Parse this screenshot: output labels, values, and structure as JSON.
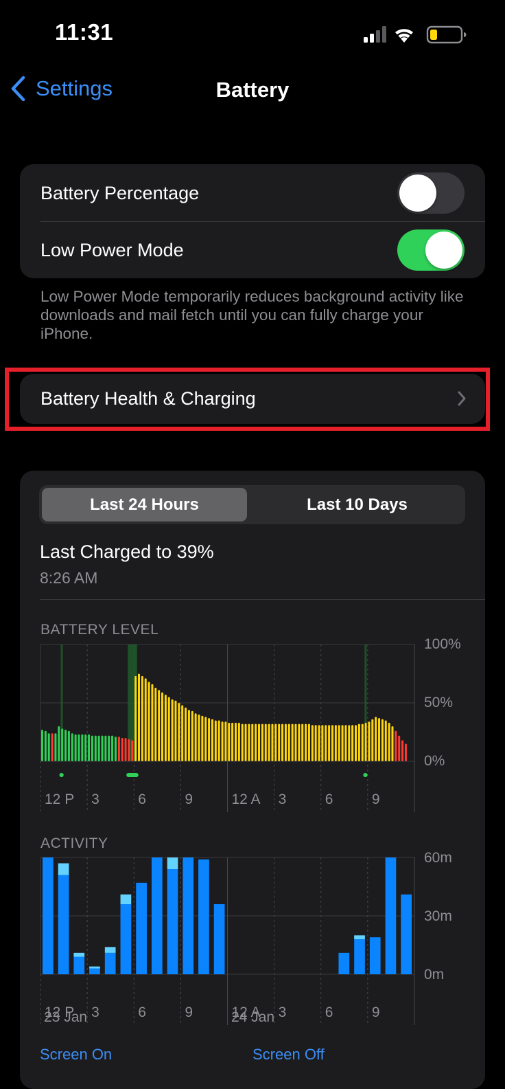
{
  "status": {
    "time": "11:31",
    "battery_color": "#ffd60a",
    "icons": [
      "cellular-signal-icon",
      "wifi-icon",
      "battery-icon"
    ]
  },
  "nav": {
    "back_label": "Settings",
    "title": "Battery"
  },
  "settings": {
    "battery_percentage": {
      "label": "Battery Percentage",
      "on": false
    },
    "low_power_mode": {
      "label": "Low Power Mode",
      "on": true,
      "on_color": "#30d158"
    },
    "footnote": "Low Power Mode temporarily reduces background activity like downloads and mail fetch until you can fully charge your iPhone."
  },
  "health": {
    "label": "Battery Health & Charging"
  },
  "usage": {
    "tabs": [
      "Last 24 Hours",
      "Last 10 Days"
    ],
    "selected_tab": 0,
    "last_charged_title": "Last Charged to 39%",
    "last_charged_time": "8:26 AM",
    "battery_level_label": "BATTERY LEVEL",
    "activity_label": "ACTIVITY",
    "battery_y_ticks": [
      "100%",
      "50%",
      "0%"
    ],
    "activity_y_ticks": [
      "60m",
      "30m",
      "0m"
    ],
    "x_ticks": [
      "12 P",
      "3",
      "6",
      "9",
      "12 A",
      "3",
      "6",
      "9"
    ],
    "dates": [
      "23 Jan",
      "24 Jan"
    ],
    "legend": [
      "Screen On",
      "Screen Off"
    ]
  },
  "chart_data": [
    {
      "type": "bar",
      "title": "BATTERY LEVEL",
      "ylim": [
        0,
        100
      ],
      "y_ticks": [
        "100%",
        "50%",
        "0%"
      ],
      "x_ticks": [
        "12 P",
        "3",
        "6",
        "9",
        "12 A",
        "3",
        "6",
        "9"
      ],
      "colors": {
        "normal": "#30d158",
        "low_power": "#ffd60a",
        "low": "#ff3b30",
        "charging": "#1f5f2c"
      },
      "values": [
        27,
        26,
        24,
        24,
        24,
        30,
        28,
        27,
        26,
        24,
        23,
        23,
        23,
        23,
        23,
        22,
        22,
        22,
        22,
        22,
        22,
        22,
        21,
        21,
        20,
        20,
        19,
        18,
        73,
        75,
        73,
        71,
        68,
        66,
        63,
        61,
        59,
        57,
        55,
        53,
        52,
        50,
        48,
        46,
        44,
        43,
        41,
        40,
        39,
        38,
        37,
        36,
        35,
        35,
        34,
        34,
        33,
        33,
        33,
        33,
        32,
        32,
        32,
        32,
        32,
        32,
        32,
        32,
        32,
        32,
        32,
        32,
        32,
        32,
        32,
        32,
        32,
        32,
        32,
        32,
        32,
        31,
        31,
        31,
        31,
        31,
        31,
        31,
        31,
        31,
        31,
        31,
        31,
        31,
        31,
        32,
        32,
        33,
        34,
        36,
        38,
        37,
        36,
        35,
        33,
        30,
        26,
        22,
        18,
        15
      ],
      "value_colors": [
        "normal",
        "normal",
        "normal",
        "low",
        "normal",
        "normal",
        "normal",
        "normal",
        "normal",
        "normal",
        "normal",
        "normal",
        "normal",
        "normal",
        "normal",
        "normal",
        "normal",
        "normal",
        "normal",
        "normal",
        "normal",
        "normal",
        "normal",
        "low",
        "low",
        "low",
        "low",
        "low",
        "low_power",
        "low_power",
        "low_power",
        "low_power",
        "low_power",
        "low_power",
        "low_power",
        "low_power",
        "low_power",
        "low_power",
        "low_power",
        "low_power",
        "low_power",
        "low_power",
        "low_power",
        "low_power",
        "low_power",
        "low_power",
        "low_power",
        "low_power",
        "low_power",
        "low_power",
        "low_power",
        "low_power",
        "low_power",
        "low_power",
        "low_power",
        "low_power",
        "low_power",
        "low_power",
        "low_power",
        "low_power",
        "low_power",
        "low_power",
        "low_power",
        "low_power",
        "low_power",
        "low_power",
        "low_power",
        "low_power",
        "low_power",
        "low_power",
        "low_power",
        "low_power",
        "low_power",
        "low_power",
        "low_power",
        "low_power",
        "low_power",
        "low_power",
        "low_power",
        "low_power",
        "low_power",
        "low_power",
        "low_power",
        "low_power",
        "low_power",
        "low_power",
        "low_power",
        "low_power",
        "low_power",
        "low_power",
        "low_power",
        "low_power",
        "low_power",
        "low_power",
        "low_power",
        "low_power",
        "low_power",
        "low_power",
        "low_power",
        "low_power",
        "low_power",
        "low_power",
        "low_power",
        "low_power",
        "low_power",
        "low_power",
        "low",
        "low",
        "low",
        "low"
      ],
      "charging_periods_hours": [
        [
          1.3,
          1.4
        ],
        [
          5.6,
          6.2
        ],
        [
          20.8,
          20.9
        ]
      ]
    },
    {
      "type": "bar",
      "title": "ACTIVITY",
      "ylim": [
        0,
        60
      ],
      "y_ticks": [
        "60m",
        "30m",
        "0m"
      ],
      "x_ticks": [
        "12 P",
        "3",
        "6",
        "9",
        "12 A",
        "3",
        "6",
        "9"
      ],
      "categories": [
        "12",
        "13",
        "14",
        "15",
        "16",
        "17",
        "18",
        "19",
        "20",
        "21",
        "22",
        "23",
        "0",
        "1",
        "2",
        "3",
        "4",
        "5",
        "6",
        "7",
        "8",
        "9",
        "10",
        "11"
      ],
      "series": [
        {
          "name": "Screen On",
          "color": "#0a84ff",
          "values": [
            60,
            51,
            9,
            3,
            11,
            36,
            47,
            60,
            54,
            60,
            59,
            36,
            0,
            0,
            0,
            0,
            0,
            0,
            0,
            11,
            18,
            19,
            60,
            41
          ]
        },
        {
          "name": "Screen Off",
          "color": "#64d2ff",
          "values": [
            0,
            6,
            2,
            1,
            3,
            5,
            0,
            0,
            6,
            0,
            0,
            0,
            0,
            0,
            0,
            0,
            0,
            0,
            0,
            0,
            2,
            0,
            0,
            0
          ]
        }
      ]
    }
  ]
}
